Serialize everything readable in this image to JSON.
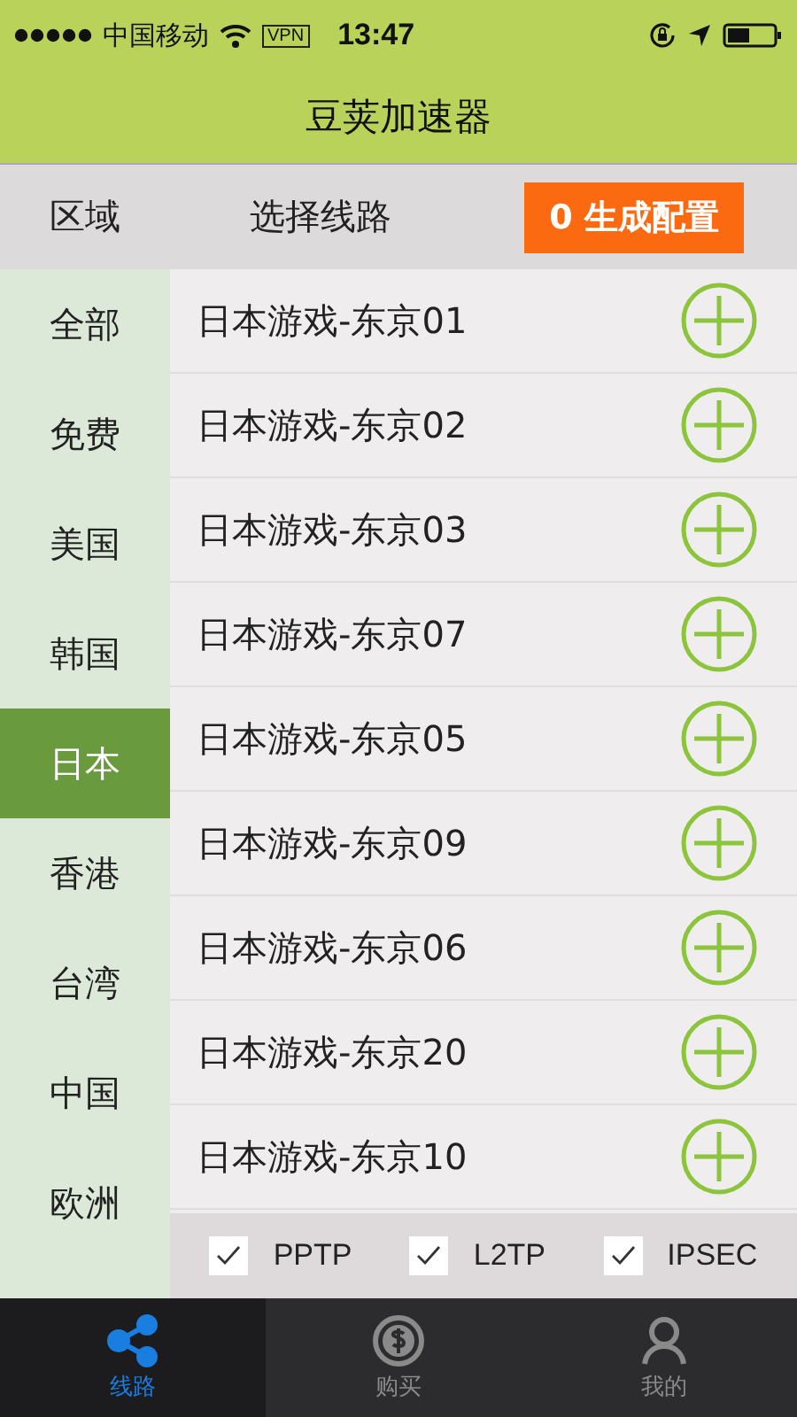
{
  "status_bar": {
    "carrier": "中国移动",
    "vpn": "VPN",
    "time": "13:47"
  },
  "header": {
    "title": "豆荚加速器"
  },
  "subheader": {
    "region_label": "区域",
    "route_label": "选择线路",
    "generate_button": "0 生成配置"
  },
  "regions": [
    {
      "label": "全部",
      "selected": false
    },
    {
      "label": "免费",
      "selected": false
    },
    {
      "label": "美国",
      "selected": false
    },
    {
      "label": "韩国",
      "selected": false
    },
    {
      "label": "日本",
      "selected": true
    },
    {
      "label": "香港",
      "selected": false
    },
    {
      "label": "台湾",
      "selected": false
    },
    {
      "label": "中国",
      "selected": false
    },
    {
      "label": "欧洲",
      "selected": false
    }
  ],
  "routes": [
    {
      "name": "日本游戏-东京01"
    },
    {
      "name": "日本游戏-东京02"
    },
    {
      "name": "日本游戏-东京03"
    },
    {
      "name": "日本游戏-东京07"
    },
    {
      "name": "日本游戏-东京05"
    },
    {
      "name": "日本游戏-东京09"
    },
    {
      "name": "日本游戏-东京06"
    },
    {
      "name": "日本游戏-东京20"
    },
    {
      "name": "日本游戏-东京10"
    }
  ],
  "protocols": [
    {
      "label": "PPTP",
      "checked": true
    },
    {
      "label": "L2TP",
      "checked": true
    },
    {
      "label": "IPSEC",
      "checked": true
    }
  ],
  "tabs": [
    {
      "label": "线路",
      "kind": "share",
      "selected": true
    },
    {
      "label": "购买",
      "kind": "dollar",
      "selected": false
    },
    {
      "label": "我的",
      "kind": "person",
      "selected": false
    }
  ]
}
